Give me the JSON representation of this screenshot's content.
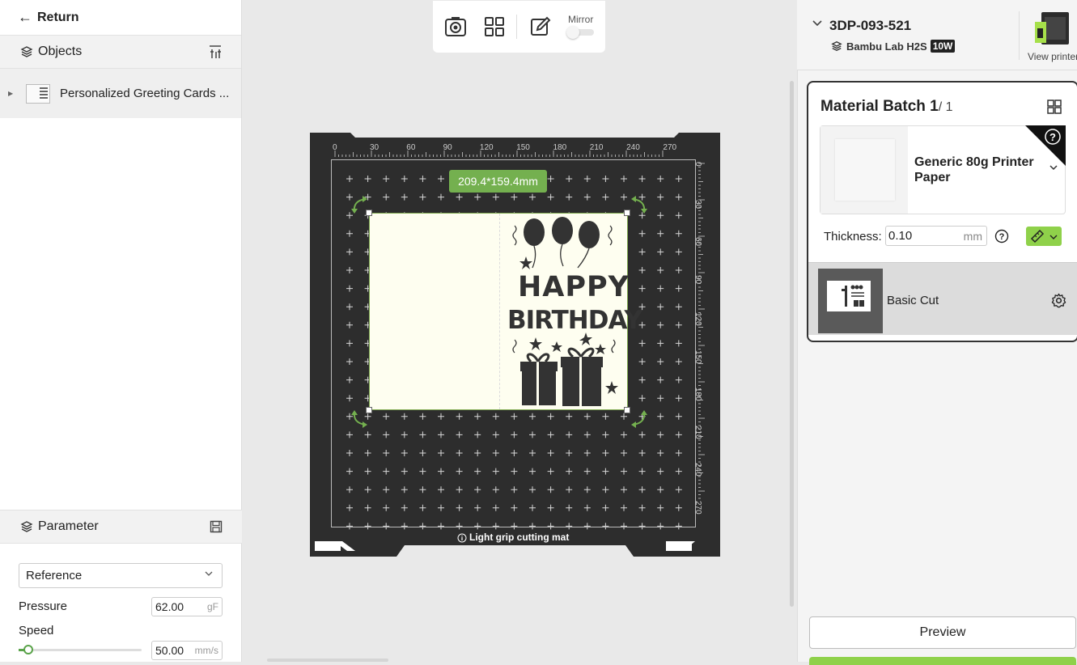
{
  "left_panel": {
    "return_label": "Return",
    "objects_title": "Objects",
    "object_item": "Personalized Greeting Cards ...",
    "parameter_title": "Parameter",
    "reference_value": "Reference",
    "pressure_label": "Pressure",
    "pressure_value": "62.00",
    "pressure_unit": "gF",
    "speed_label": "Speed",
    "speed_value": "50.00",
    "speed_unit": "mm/s"
  },
  "toolbar": {
    "mirror_label": "Mirror",
    "mirror_on": false
  },
  "canvas": {
    "dimension_badge": "209.4*159.4mm",
    "mat_label": "Light grip cutting mat",
    "ruler_top": [
      "0",
      "30",
      "60",
      "90",
      "120",
      "150",
      "180",
      "210",
      "240",
      "270"
    ],
    "ruler_right": [
      "0",
      "30",
      "60",
      "90",
      "120",
      "150",
      "180",
      "210",
      "240",
      "270"
    ],
    "card_text_line1": "HAPPY",
    "card_text_line2": "BIRTHDAY",
    "accent_color": "#74b04f"
  },
  "printer": {
    "name": "3DP-093-521",
    "model": "Bambu Lab H2S",
    "model_badge": "10W",
    "view_label": "View printer"
  },
  "batch": {
    "title": "Material Batch 1",
    "count": "/ 1",
    "material_name": "Generic 80g Printer Paper",
    "thickness_label": "Thickness:",
    "thickness_value": "0.10",
    "thickness_unit": "mm",
    "cut_name": "Basic Cut"
  },
  "actions": {
    "preview_label": "Preview"
  }
}
